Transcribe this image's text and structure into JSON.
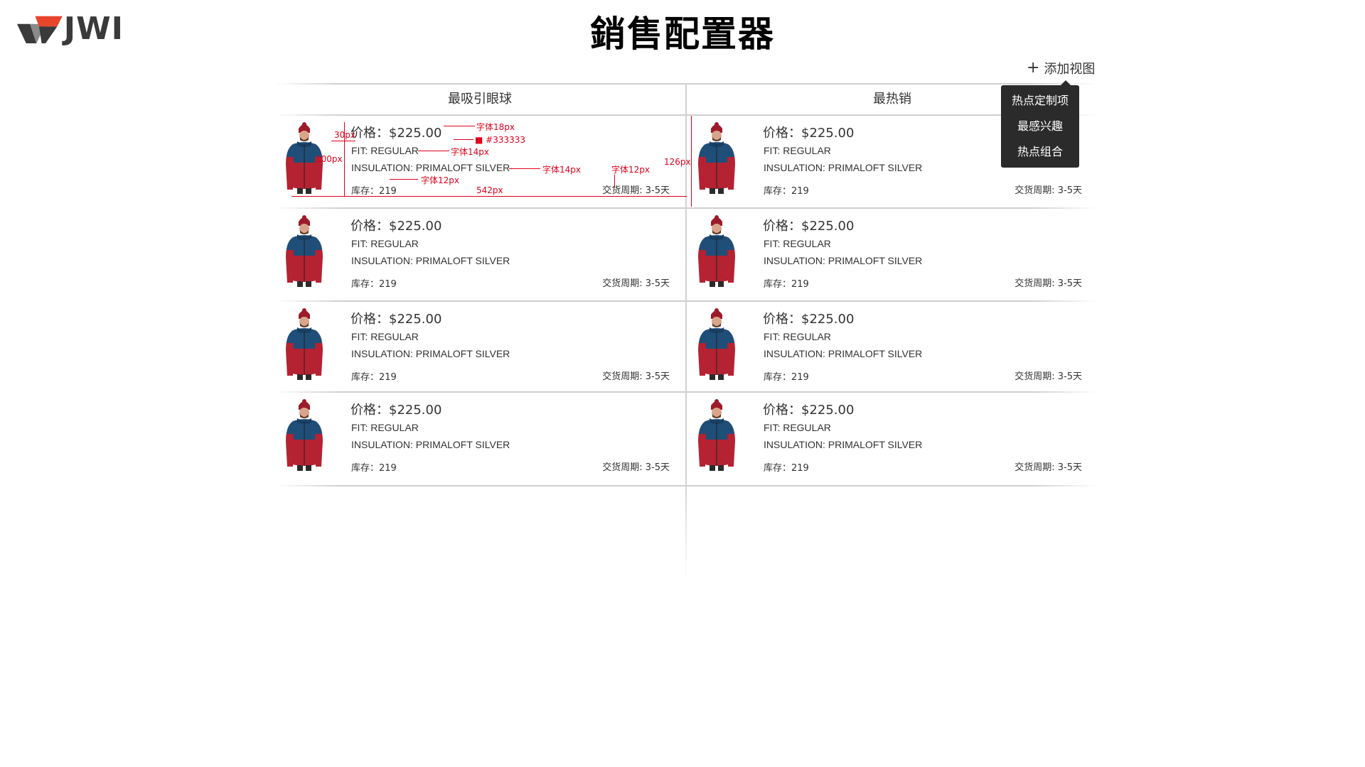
{
  "brand": {
    "logo_text": "JWI",
    "logo_colors": {
      "red": "#e8452b",
      "dark": "#3a3a3a",
      "gray": "#8a8a8a"
    }
  },
  "page_title": "銷售配置器",
  "add_view": {
    "label": "添加视图",
    "icon": "plus-icon"
  },
  "dropdown": {
    "items": [
      "热点定制项",
      "最感兴趣",
      "热点组合"
    ]
  },
  "columns": [
    {
      "title": "最吸引眼球"
    },
    {
      "title": "最热销"
    }
  ],
  "products": {
    "col1": [
      {
        "price": "价格：$225.00",
        "fit": "FIT: REGULAR",
        "insulation": "INSULATION: PRIMALOFT SILVER",
        "stock": "库存：219",
        "lead": "交货周期: 3-5天"
      },
      {
        "price": "价格：$225.00",
        "fit": "FIT: REGULAR",
        "insulation": "INSULATION: PRIMALOFT SILVER",
        "stock": "库存：219",
        "lead": "交货周期: 3-5天"
      },
      {
        "price": "价格：$225.00",
        "fit": "FIT: REGULAR",
        "insulation": "INSULATION: PRIMALOFT SILVER",
        "stock": "库存：219",
        "lead": "交货周期: 3-5天"
      },
      {
        "price": "价格：$225.00",
        "fit": "FIT: REGULAR",
        "insulation": "INSULATION: PRIMALOFT SILVER",
        "stock": "库存：219",
        "lead": "交货周期: 3-5天"
      }
    ],
    "col2": [
      {
        "price": "价格：$225.00",
        "fit": "FIT: REGULAR",
        "insulation": "INSULATION: PRIMALOFT SILVER",
        "stock": "库存：219",
        "lead": "交货周期: 3-5天"
      },
      {
        "price": "价格：$225.00",
        "fit": "FIT: REGULAR",
        "insulation": "INSULATION: PRIMALOFT SILVER",
        "stock": "库存：219",
        "lead": "交货周期: 3-5天"
      },
      {
        "price": "价格：$225.00",
        "fit": "FIT: REGULAR",
        "insulation": "INSULATION: PRIMALOFT SILVER",
        "stock": "库存：219",
        "lead": "交货周期: 3-5天"
      },
      {
        "price": "价格：$225.00",
        "fit": "FIT: REGULAR",
        "insulation": "INSULATION: PRIMALOFT SILVER",
        "stock": "库存：219",
        "lead": "交货周期: 3-5天"
      }
    ]
  },
  "annotations": {
    "font18": "字体18px",
    "color": "■ #333333",
    "font14a": "字体14px",
    "font14b": "字体14px",
    "font12a": "字体12px",
    "font12b": "字体12px",
    "w30": "30px",
    "h100": "100px",
    "w542": "542px",
    "h126": "126px",
    "color_hex": "#e0001b"
  },
  "jacket_colors": {
    "navy": "#1f4e79",
    "red": "#b52232",
    "skin": "#d9a58a",
    "cap": "#9c1b2a"
  }
}
